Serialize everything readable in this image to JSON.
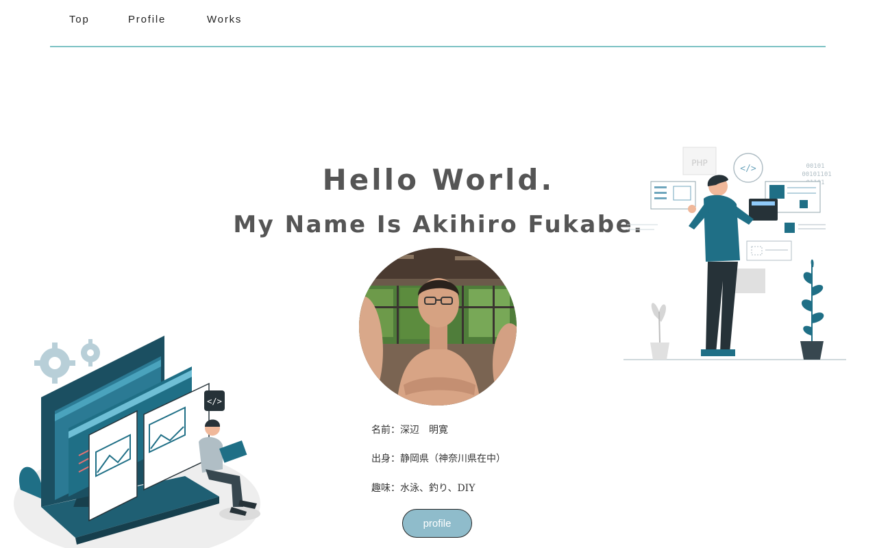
{
  "nav": {
    "items": [
      {
        "label": "Top"
      },
      {
        "label": "Profile"
      },
      {
        "label": "Works"
      }
    ]
  },
  "hero": {
    "title": "Hello World.",
    "subtitle": "My Name Is Akihiro Fukabe."
  },
  "profile": {
    "name_line": "名前：深辺　明寛",
    "origin_line": "出身：静岡県（神奈川県在中）",
    "hobby_line": "趣味：水泳、釣り、DIY",
    "button_label": "profile"
  },
  "illustration_right": {
    "php_label": "PHP",
    "code_tag": "</>",
    "binary_1": "00101",
    "binary_2": "00101101",
    "binary_3": "01101"
  },
  "illustration_left": {
    "code_tag": "</>"
  },
  "colors": {
    "accent_teal": "#1f6f86",
    "nav_rule": "#7cc2c4",
    "button_bg": "#8fbccb",
    "dark_navy": "#263238"
  }
}
